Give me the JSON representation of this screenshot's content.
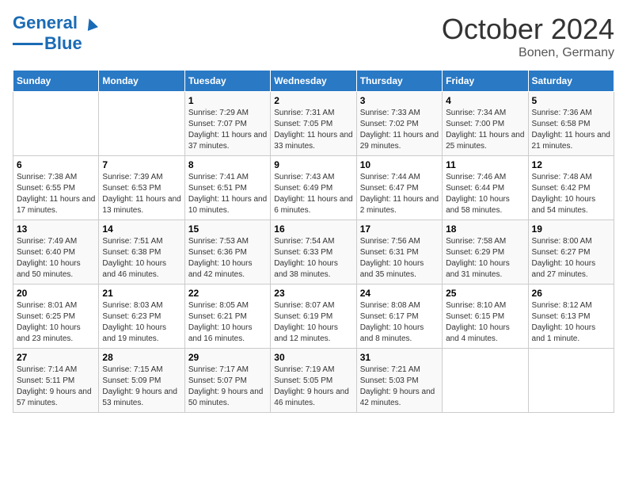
{
  "header": {
    "logo_line1": "General",
    "logo_line2": "Blue",
    "month": "October 2024",
    "location": "Bonen, Germany"
  },
  "weekdays": [
    "Sunday",
    "Monday",
    "Tuesday",
    "Wednesday",
    "Thursday",
    "Friday",
    "Saturday"
  ],
  "weeks": [
    [
      {
        "day": "",
        "info": ""
      },
      {
        "day": "",
        "info": ""
      },
      {
        "day": "1",
        "info": "Sunrise: 7:29 AM\nSunset: 7:07 PM\nDaylight: 11 hours and 37 minutes."
      },
      {
        "day": "2",
        "info": "Sunrise: 7:31 AM\nSunset: 7:05 PM\nDaylight: 11 hours and 33 minutes."
      },
      {
        "day": "3",
        "info": "Sunrise: 7:33 AM\nSunset: 7:02 PM\nDaylight: 11 hours and 29 minutes."
      },
      {
        "day": "4",
        "info": "Sunrise: 7:34 AM\nSunset: 7:00 PM\nDaylight: 11 hours and 25 minutes."
      },
      {
        "day": "5",
        "info": "Sunrise: 7:36 AM\nSunset: 6:58 PM\nDaylight: 11 hours and 21 minutes."
      }
    ],
    [
      {
        "day": "6",
        "info": "Sunrise: 7:38 AM\nSunset: 6:55 PM\nDaylight: 11 hours and 17 minutes."
      },
      {
        "day": "7",
        "info": "Sunrise: 7:39 AM\nSunset: 6:53 PM\nDaylight: 11 hours and 13 minutes."
      },
      {
        "day": "8",
        "info": "Sunrise: 7:41 AM\nSunset: 6:51 PM\nDaylight: 11 hours and 10 minutes."
      },
      {
        "day": "9",
        "info": "Sunrise: 7:43 AM\nSunset: 6:49 PM\nDaylight: 11 hours and 6 minutes."
      },
      {
        "day": "10",
        "info": "Sunrise: 7:44 AM\nSunset: 6:47 PM\nDaylight: 11 hours and 2 minutes."
      },
      {
        "day": "11",
        "info": "Sunrise: 7:46 AM\nSunset: 6:44 PM\nDaylight: 10 hours and 58 minutes."
      },
      {
        "day": "12",
        "info": "Sunrise: 7:48 AM\nSunset: 6:42 PM\nDaylight: 10 hours and 54 minutes."
      }
    ],
    [
      {
        "day": "13",
        "info": "Sunrise: 7:49 AM\nSunset: 6:40 PM\nDaylight: 10 hours and 50 minutes."
      },
      {
        "day": "14",
        "info": "Sunrise: 7:51 AM\nSunset: 6:38 PM\nDaylight: 10 hours and 46 minutes."
      },
      {
        "day": "15",
        "info": "Sunrise: 7:53 AM\nSunset: 6:36 PM\nDaylight: 10 hours and 42 minutes."
      },
      {
        "day": "16",
        "info": "Sunrise: 7:54 AM\nSunset: 6:33 PM\nDaylight: 10 hours and 38 minutes."
      },
      {
        "day": "17",
        "info": "Sunrise: 7:56 AM\nSunset: 6:31 PM\nDaylight: 10 hours and 35 minutes."
      },
      {
        "day": "18",
        "info": "Sunrise: 7:58 AM\nSunset: 6:29 PM\nDaylight: 10 hours and 31 minutes."
      },
      {
        "day": "19",
        "info": "Sunrise: 8:00 AM\nSunset: 6:27 PM\nDaylight: 10 hours and 27 minutes."
      }
    ],
    [
      {
        "day": "20",
        "info": "Sunrise: 8:01 AM\nSunset: 6:25 PM\nDaylight: 10 hours and 23 minutes."
      },
      {
        "day": "21",
        "info": "Sunrise: 8:03 AM\nSunset: 6:23 PM\nDaylight: 10 hours and 19 minutes."
      },
      {
        "day": "22",
        "info": "Sunrise: 8:05 AM\nSunset: 6:21 PM\nDaylight: 10 hours and 16 minutes."
      },
      {
        "day": "23",
        "info": "Sunrise: 8:07 AM\nSunset: 6:19 PM\nDaylight: 10 hours and 12 minutes."
      },
      {
        "day": "24",
        "info": "Sunrise: 8:08 AM\nSunset: 6:17 PM\nDaylight: 10 hours and 8 minutes."
      },
      {
        "day": "25",
        "info": "Sunrise: 8:10 AM\nSunset: 6:15 PM\nDaylight: 10 hours and 4 minutes."
      },
      {
        "day": "26",
        "info": "Sunrise: 8:12 AM\nSunset: 6:13 PM\nDaylight: 10 hours and 1 minute."
      }
    ],
    [
      {
        "day": "27",
        "info": "Sunrise: 7:14 AM\nSunset: 5:11 PM\nDaylight: 9 hours and 57 minutes."
      },
      {
        "day": "28",
        "info": "Sunrise: 7:15 AM\nSunset: 5:09 PM\nDaylight: 9 hours and 53 minutes."
      },
      {
        "day": "29",
        "info": "Sunrise: 7:17 AM\nSunset: 5:07 PM\nDaylight: 9 hours and 50 minutes."
      },
      {
        "day": "30",
        "info": "Sunrise: 7:19 AM\nSunset: 5:05 PM\nDaylight: 9 hours and 46 minutes."
      },
      {
        "day": "31",
        "info": "Sunrise: 7:21 AM\nSunset: 5:03 PM\nDaylight: 9 hours and 42 minutes."
      },
      {
        "day": "",
        "info": ""
      },
      {
        "day": "",
        "info": ""
      }
    ]
  ]
}
